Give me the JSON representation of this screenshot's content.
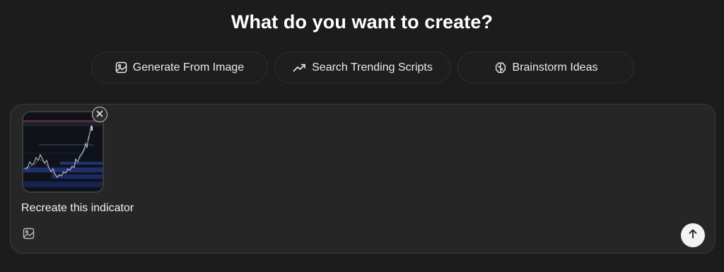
{
  "heading": "What do you want to create?",
  "suggestions": [
    {
      "label": "Generate From Image",
      "icon": "image-icon"
    },
    {
      "label": "Search Trending Scripts",
      "icon": "trending-up-icon"
    },
    {
      "label": "Brainstorm Ideas",
      "icon": "brain-icon"
    }
  ],
  "composer": {
    "attachment": {
      "kind": "chart-screenshot",
      "remove_icon": "close-icon"
    },
    "prompt_text": "Recreate this indicator",
    "attach_icon": "image-icon",
    "send_icon": "arrow-up-icon"
  },
  "colors": {
    "background": "#1c1c1c",
    "composer": "#262626",
    "chip_border": "#2f2f2f",
    "send_button": "#f2f2f2"
  }
}
